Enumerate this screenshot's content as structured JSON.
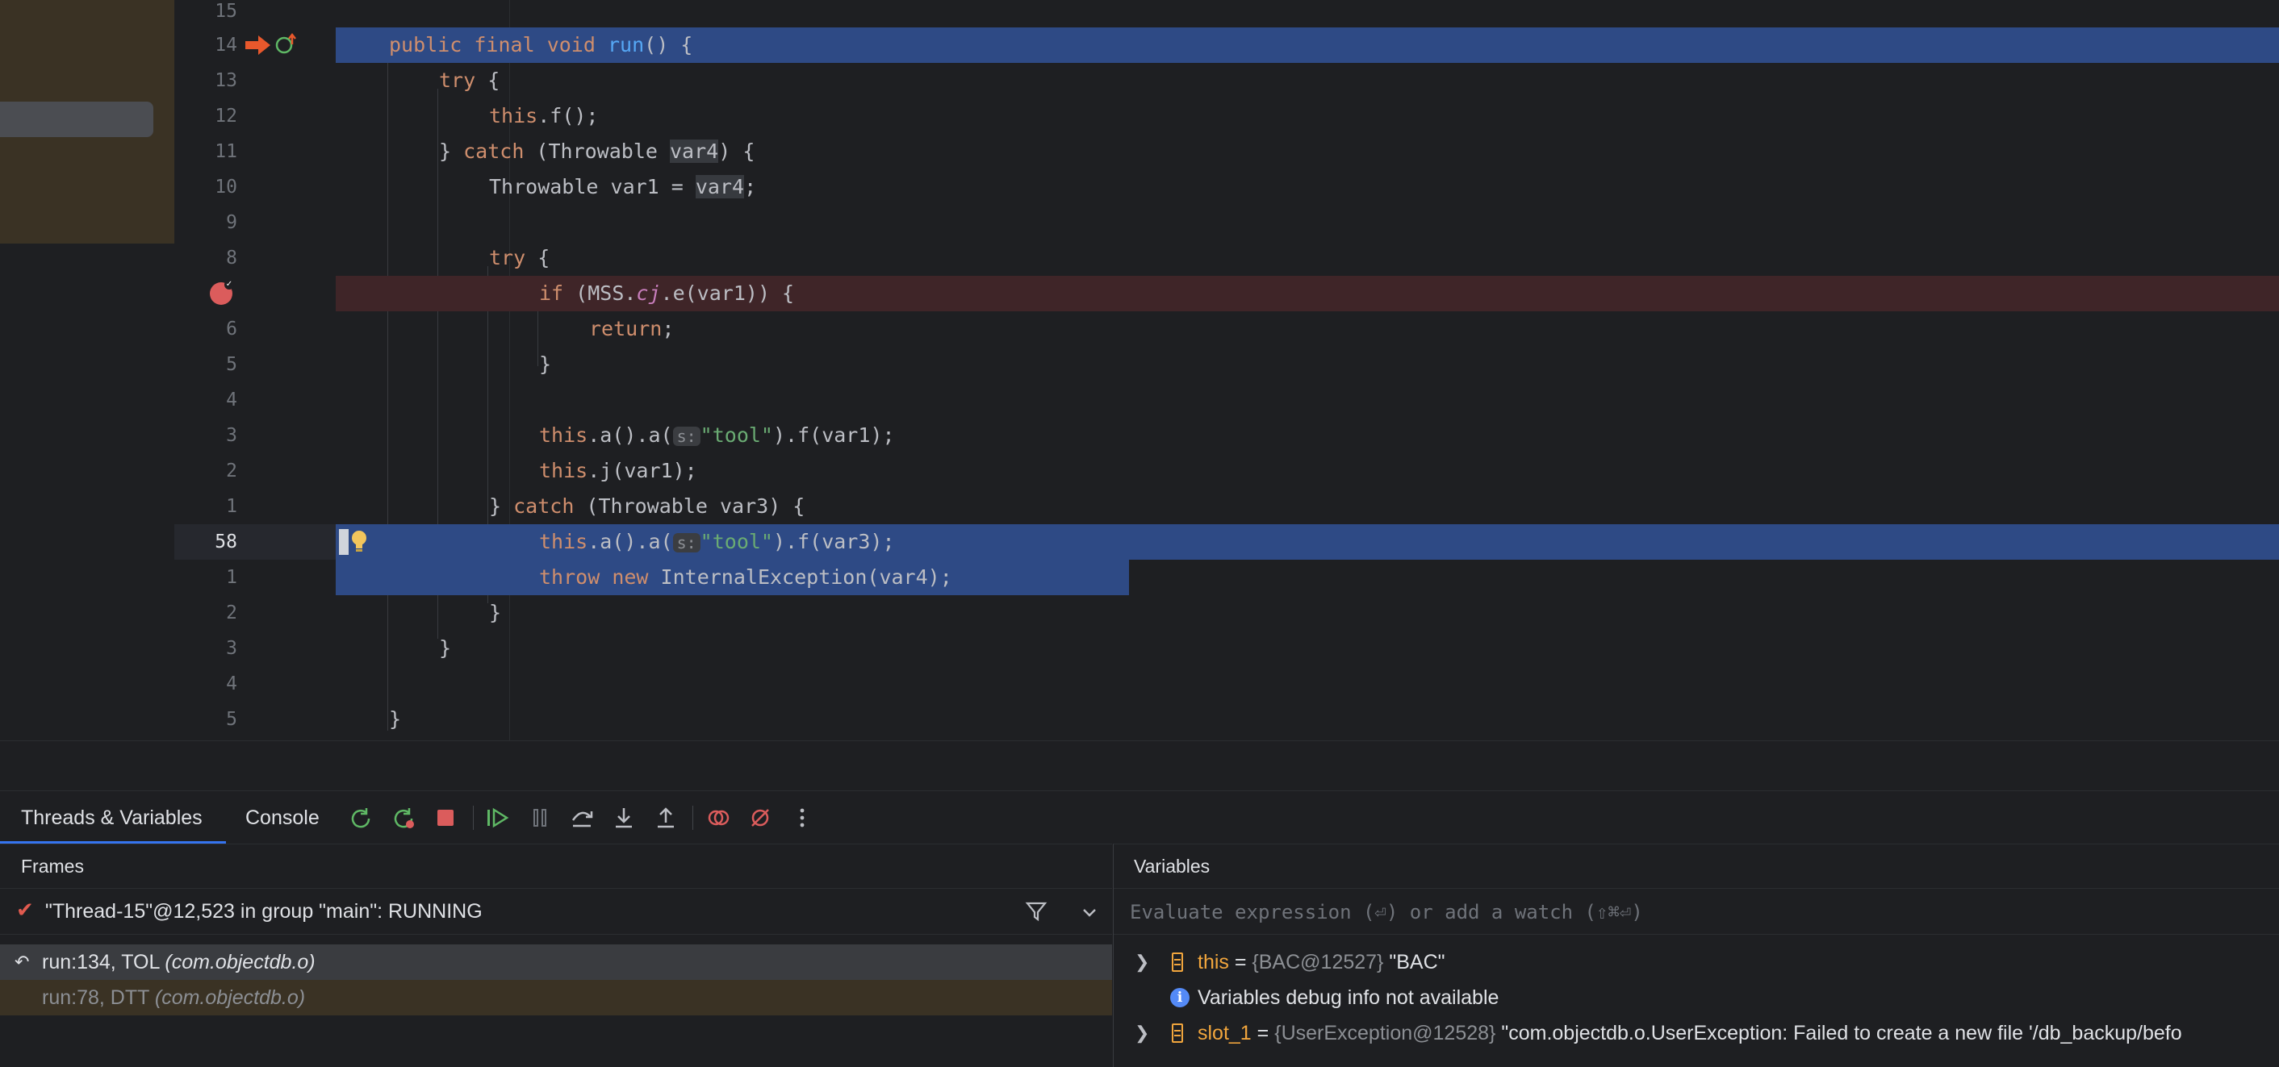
{
  "editor": {
    "lines": [
      {
        "num": "15"
      },
      {
        "num": "14"
      },
      {
        "num": "13"
      },
      {
        "num": "12"
      },
      {
        "num": "11"
      },
      {
        "num": "10"
      },
      {
        "num": "9"
      },
      {
        "num": "8"
      },
      {
        "num": ""
      },
      {
        "num": "6"
      },
      {
        "num": "5"
      },
      {
        "num": "4"
      },
      {
        "num": "3"
      },
      {
        "num": "2"
      },
      {
        "num": "1"
      },
      {
        "num": "58"
      },
      {
        "num": "1"
      },
      {
        "num": "2"
      },
      {
        "num": "3"
      },
      {
        "num": "4"
      },
      {
        "num": "5"
      }
    ],
    "code": {
      "l14_public": "public",
      "l14_final": "final",
      "l14_void": "void",
      "l14_run": "run",
      "l14_rest": "() {",
      "l13_try": "try",
      "l13_rest": " {",
      "l12_this": "this",
      "l12_rest": ".f();",
      "l11_a": "} ",
      "l11_catch": "catch",
      "l11_b": " (Throwable ",
      "l11_var": "var4",
      "l11_c": ") {",
      "l10_a": "Throwable var1 = ",
      "l10_var": "var4",
      "l10_b": ";",
      "l8_try": "try",
      "l8_rest": " {",
      "l7_if": "if",
      "l7_a": " (MSS.",
      "l7_cj": "cj",
      "l7_b": ".e(var1)) {",
      "l6_return": "return",
      "l6_rest": ";",
      "l5": "}",
      "l3_this": "this",
      "l3_a": ".a().a(",
      "l3_hint": "s:",
      "l3_str": "\"tool\"",
      "l3_b": ").f(var1);",
      "l2_this": "this",
      "l2_rest": ".j(var1);",
      "l1_a": "} ",
      "l1_catch": "catch",
      "l1_b": " (Throwable var3) {",
      "l58_this": "this",
      "l58_a": ".a().a(",
      "l58_hint": "s:",
      "l58_str": "\"tool\"",
      "l58_b": ").f(var3);",
      "l1b_throw": "throw",
      "l1b_new": "new",
      "l1b_rest": " InternalException(var4);",
      "l2b": "}",
      "l3b": "}",
      "l5b": "}"
    }
  },
  "tool_window": {
    "tabs": [
      {
        "label": "Threads & Variables"
      },
      {
        "label": "Console"
      }
    ],
    "toolbar_icons": [
      "rerun-icon",
      "rerun-failed-icon",
      "stop-icon",
      "resume-icon",
      "pause-icon",
      "step-over-icon",
      "step-into-icon",
      "step-out-icon",
      "view-breakpoints-icon",
      "mute-breakpoints-icon",
      "more-icon"
    ],
    "colors": {
      "accent": "#3574f0",
      "stop": "#db5c5c",
      "resume": "#5fb865"
    }
  },
  "frames": {
    "title": "Frames",
    "thread": "\"Thread-15\"@12,523 in group \"main\": RUNNING",
    "items": [
      {
        "method": "run:134, TOL ",
        "pkg": "(com.objectdb.o)"
      },
      {
        "method": "run:78, DTT ",
        "pkg": "(com.objectdb.o)"
      }
    ]
  },
  "variables": {
    "title": "Variables",
    "eval_placeholder": "Evaluate expression (⏎) or add a watch (⇧⌘⏎)",
    "rows": [
      {
        "name": "this",
        "eq": " = ",
        "type": "{BAC@12527}",
        "value": " \"BAC\""
      },
      {
        "info": "Variables debug info not available"
      },
      {
        "name": "slot_1",
        "eq": " = ",
        "type": "{UserException@12528}",
        "value": " \"com.objectdb.o.UserException: Failed to create a new file '/db_backup/befo"
      }
    ]
  }
}
